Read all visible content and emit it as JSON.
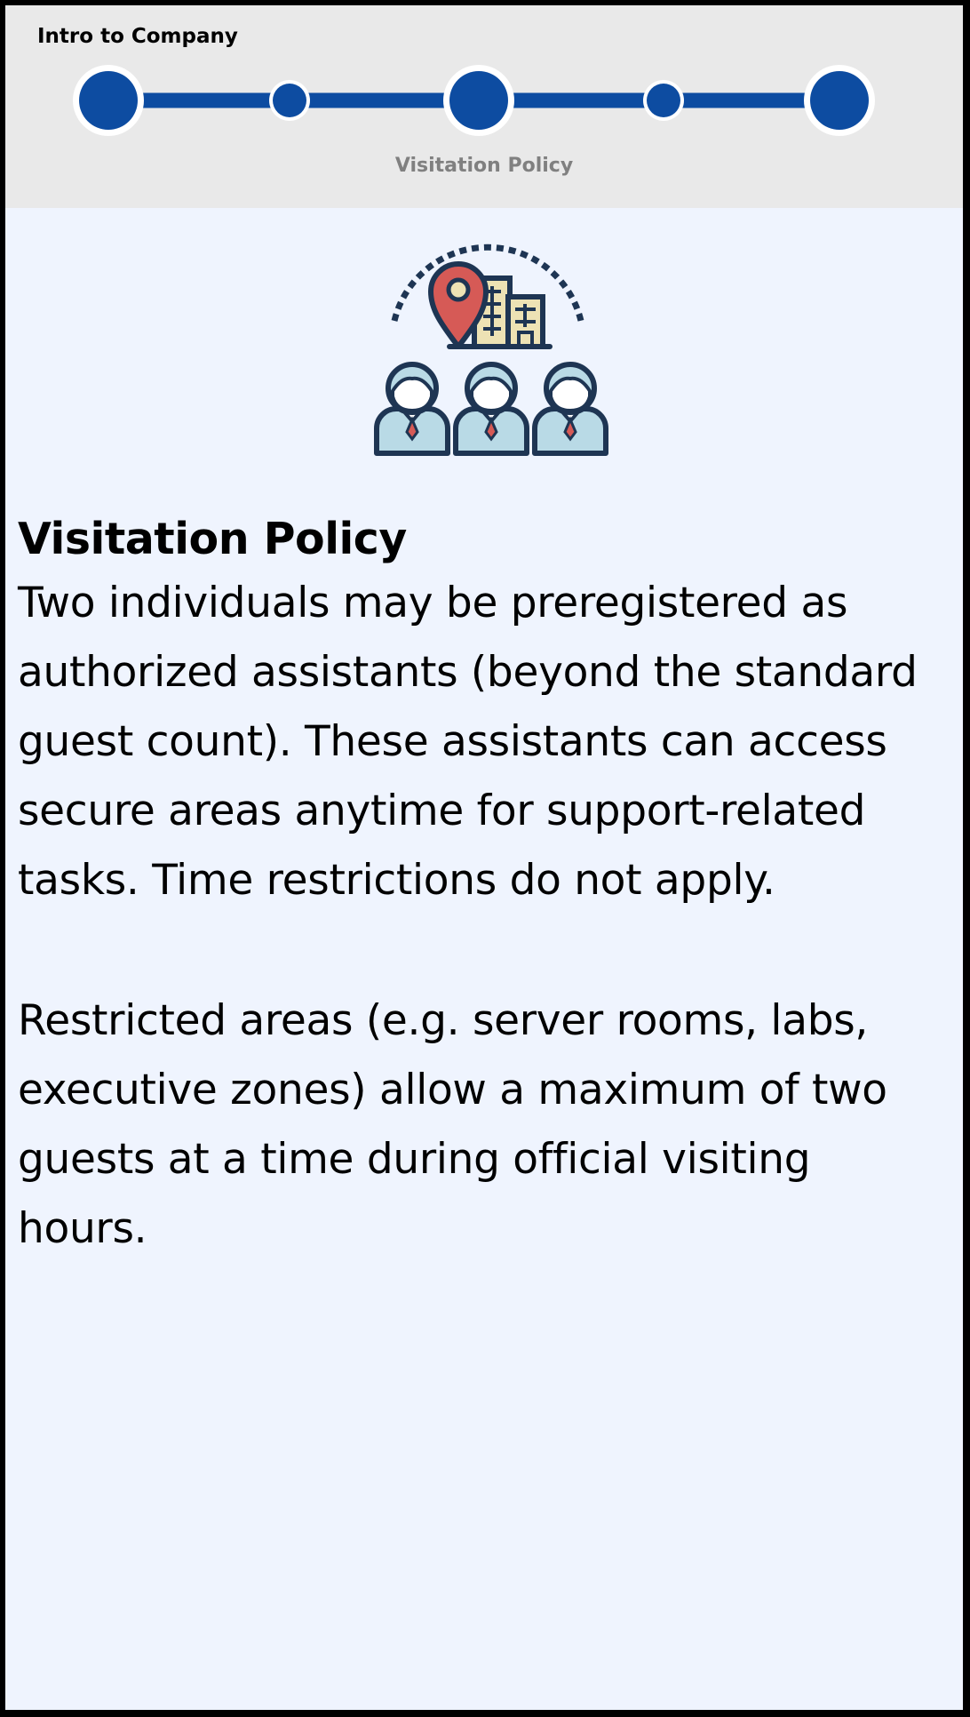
{
  "header": {
    "title": "Intro to Company",
    "step_caption": "Visitation Policy",
    "total_steps": 5,
    "current_step": 3
  },
  "illustration": {
    "icon": "visitation-policy-icon"
  },
  "content": {
    "heading": "Visitation Policy",
    "paragraph_1": "Two individuals may be preregistered as authorized assistants (beyond the standard guest count). These assistants can access secure areas anytime for support-related tasks. Time restrictions do not apply.",
    "paragraph_2": "Restricted areas (e.g. server rooms, labs, executive zones) allow a maximum of two guests at a time during official visiting hours."
  },
  "colors": {
    "accent": "#0d4ca1",
    "header_bg": "#e9e9e9",
    "content_bg": "#eff4fe",
    "caption": "#808080",
    "pin": "#d65a56",
    "building": "#ede2b4",
    "person": "#b9dae6",
    "outline": "#1e3553"
  }
}
